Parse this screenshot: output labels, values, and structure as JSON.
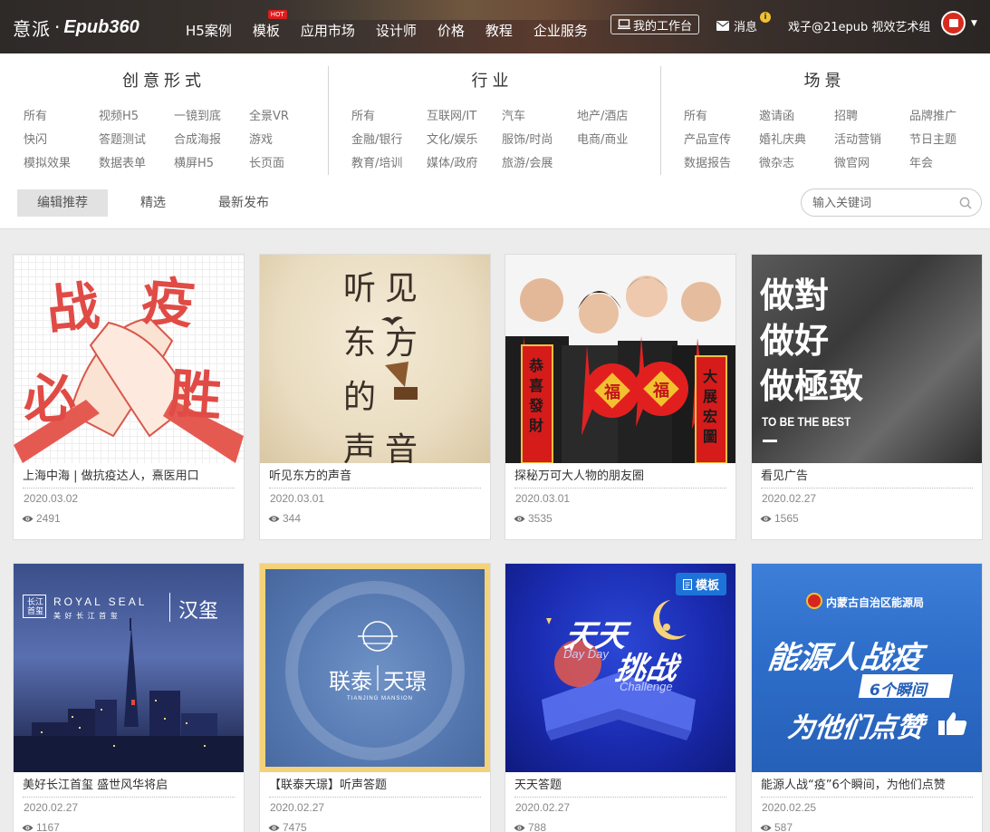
{
  "header": {
    "logo_cn": "意派",
    "logo_dot": "·",
    "logo_en": "Epub360",
    "nav": [
      {
        "label": "H5案例"
      },
      {
        "label": "模板",
        "badge": "HOT"
      },
      {
        "label": "应用市场"
      },
      {
        "label": "设计师"
      },
      {
        "label": "价格"
      },
      {
        "label": "教程"
      },
      {
        "label": "企业服务"
      }
    ],
    "workbench": "我的工作台",
    "messages": "消息",
    "messages_badge": "i",
    "user": "戏子@21epub 视效艺术组",
    "caret": "▼"
  },
  "filters": {
    "form": {
      "heading": "创意形式",
      "items": [
        "所有",
        "视频H5",
        "一镜到底",
        "全景VR",
        "快闪",
        "答题测试",
        "合成海报",
        "游戏",
        "模拟效果",
        "数据表单",
        "横屏H5",
        "长页面"
      ]
    },
    "industry": {
      "heading": "行业",
      "items": [
        "所有",
        "互联网/IT",
        "汽车",
        "地产/酒店",
        "金融/银行",
        "文化/娱乐",
        "服饰/时尚",
        "电商/商业",
        "教育/培训",
        "媒体/政府",
        "旅游/会展"
      ]
    },
    "scene": {
      "heading": "场景",
      "items": [
        "所有",
        "邀请函",
        "招聘",
        "品牌推广",
        "产品宣传",
        "婚礼庆典",
        "活动营销",
        "节日主题",
        "数据报告",
        "微杂志",
        "微官网",
        "年会"
      ]
    }
  },
  "tabs": [
    "编辑推荐",
    "精选",
    "最新发布"
  ],
  "search": {
    "placeholder": "输入关键词"
  },
  "cards": [
    {
      "title": "上海中海 | 做抗疫达人，熹医用口",
      "date": "2020.03.02",
      "views": "2491",
      "art": [
        "战",
        "疫",
        "必",
        "胜"
      ]
    },
    {
      "title": "听见东方的声音",
      "date": "2020.03.01",
      "views": "344",
      "art": [
        "听",
        "见",
        "东",
        "方",
        "的",
        "声",
        "音"
      ]
    },
    {
      "title": "探秘万可大人物的朋友圈",
      "date": "2020.03.01",
      "views": "3535",
      "art": [
        "恭喜發財",
        "大展宏圖",
        "福",
        "福"
      ]
    },
    {
      "title": "看见广告",
      "date": "2020.02.27",
      "views": "1565",
      "art": [
        "做對",
        "做好",
        "做極致",
        "TO BE THE BEST"
      ]
    },
    {
      "title": "美好长江首玺 盛世风华将启",
      "date": "2020.02.27",
      "views": "1167",
      "art": [
        "ROYAL SEAL",
        "汉玺",
        "美 好 长 江 首 玺",
        "长江首玺"
      ]
    },
    {
      "title": "【联泰天璟】听声答题",
      "date": "2020.02.27",
      "views": "7475",
      "art": [
        "联泰",
        "天璟",
        "TIANJING MANSION"
      ]
    },
    {
      "title": "天天答题",
      "date": "2020.02.27",
      "views": "788",
      "badge": "模板",
      "art": [
        "天天",
        "挑战",
        "Day Day",
        "Challenge"
      ]
    },
    {
      "title": "能源人战“疫”6个瞬间，为他们点赞",
      "date": "2020.02.25",
      "views": "587",
      "art": [
        "内蒙古自治区能源局",
        "能源人战疫",
        "6个瞬间",
        "为他们点赞"
      ]
    }
  ],
  "colors": {
    "accent": "#1e73d8",
    "red": "#d72b1f"
  }
}
